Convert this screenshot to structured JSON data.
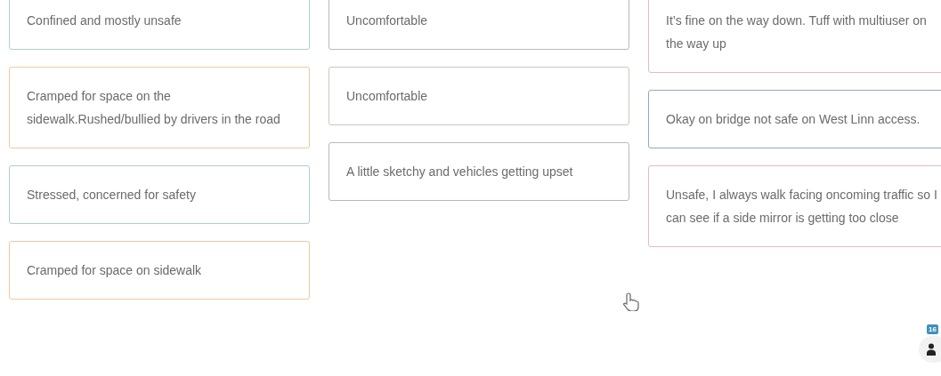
{
  "columns": [
    {
      "cards": [
        {
          "text": "Confined and mostly unsafe",
          "color": "#a9d0d6"
        },
        {
          "text": "Cramped for space on the sidewalk.Rushed/bullied by drivers in the road",
          "color": "#f2c7a0"
        },
        {
          "text": "Stressed, concerned for safety",
          "color": "#a9d0d6"
        },
        {
          "text": "Cramped for space on sidewalk",
          "color": "#f2c7a0"
        }
      ]
    },
    {
      "cards": [
        {
          "text": "Uncomfortable",
          "color": "#b8b8b8"
        },
        {
          "text": "Uncomfortable",
          "color": "#c9c9c0"
        },
        {
          "text": "A little sketchy and vehicles getting upset",
          "color": "#b8b8b8"
        }
      ]
    },
    {
      "cards": [
        {
          "text": "It’s fine on the way down. Tuff with multiuser on the way up",
          "color": "#e6b9c1"
        },
        {
          "text": "Okay on bridge not safe on West Linn access.",
          "color": "#8fa9c4"
        },
        {
          "text": "Unsafe, I always walk facing oncoming traffic so I can see if a side mirror is getting too close",
          "color": "#e6b9c1"
        }
      ]
    }
  ],
  "participants": {
    "count": "16"
  }
}
